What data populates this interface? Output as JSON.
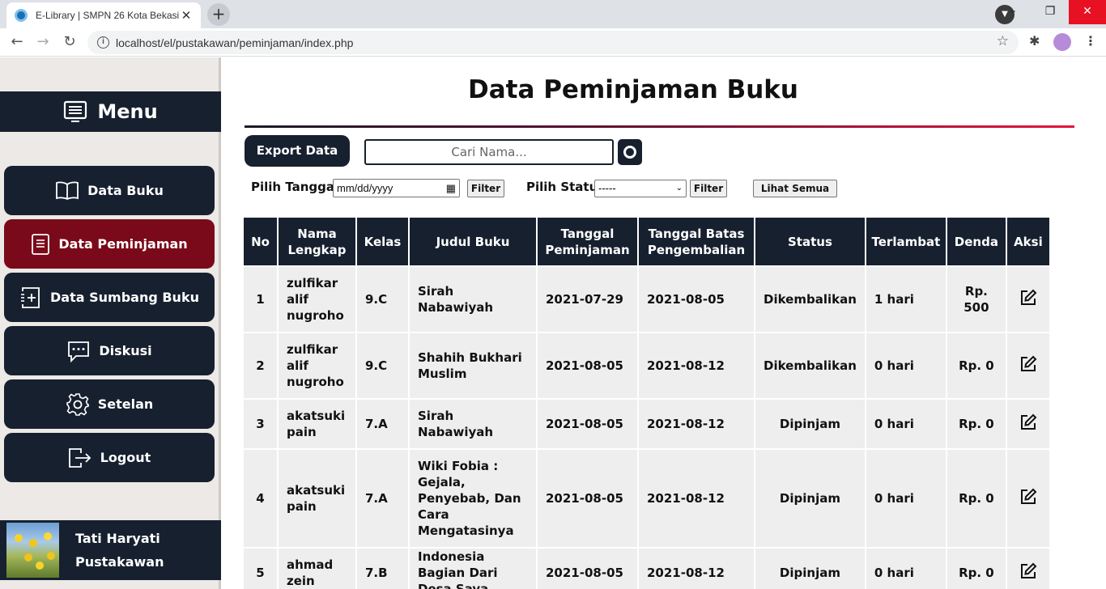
{
  "browser": {
    "tab_title": "E-Library | SMPN 26 Kota Bekasi",
    "url": "localhost/el/pustakawan/peminjaman/index.php"
  },
  "sidebar": {
    "menu_title": "Menu",
    "items": [
      {
        "label": "Data Buku",
        "icon": "book-icon"
      },
      {
        "label": "Data Peminjaman",
        "icon": "document-icon",
        "active": true
      },
      {
        "label": "Data Sumbang Buku",
        "icon": "add-file-icon"
      },
      {
        "label": "Diskusi",
        "icon": "chat-icon"
      },
      {
        "label": "Setelan",
        "icon": "gear-icon"
      },
      {
        "label": "Logout",
        "icon": "logout-icon"
      }
    ],
    "user": {
      "name": "Tati Haryati",
      "role": "Pustakawan"
    }
  },
  "main": {
    "title": "Data Peminjaman Buku",
    "export_label": "Export Data",
    "search_placeholder": "Cari Nama...",
    "filters": {
      "date_label": "Pilih Tanggal",
      "date_value": "mm/dd/yyyy",
      "filter_label": "Filter",
      "status_label": "Pilih Status",
      "status_value": "-----",
      "show_all_label": "Lihat Semua"
    },
    "table": {
      "headers": [
        "No",
        "Nama Lengkap",
        "Kelas",
        "Judul Buku",
        "Tanggal Peminjaman",
        "Tanggal Batas Pengembalian",
        "Status",
        "Terlambat",
        "Denda",
        "Aksi"
      ],
      "rows": [
        {
          "no": "1",
          "nama": "zulfikar alif nugroho",
          "kelas": "9.C",
          "judul": "Sirah Nabawiyah",
          "pinjam": "2021-07-29",
          "batas": "2021-08-05",
          "status": "Dikembalikan",
          "terlambat": "1 hari",
          "denda": "Rp. 500"
        },
        {
          "no": "2",
          "nama": "zulfikar alif nugroho",
          "kelas": "9.C",
          "judul": "Shahih Bukhari Muslim",
          "pinjam": "2021-08-05",
          "batas": "2021-08-12",
          "status": "Dikembalikan",
          "terlambat": "0 hari",
          "denda": "Rp. 0"
        },
        {
          "no": "3",
          "nama": "akatsuki pain",
          "kelas": "7.A",
          "judul": "Sirah Nabawiyah",
          "pinjam": "2021-08-05",
          "batas": "2021-08-12",
          "status": "Dipinjam",
          "terlambat": "0 hari",
          "denda": "Rp. 0"
        },
        {
          "no": "4",
          "nama": "akatsuki pain",
          "kelas": "7.A",
          "judul": "Wiki Fobia : Gejala, Penyebab, Dan Cara Mengatasinya",
          "pinjam": "2021-08-05",
          "batas": "2021-08-12",
          "status": "Dipinjam",
          "terlambat": "0 hari",
          "denda": "Rp. 0"
        },
        {
          "no": "5",
          "nama": "ahmad zein",
          "kelas": "7.B",
          "judul": "Indonesia Bagian Dari Desa Saya",
          "pinjam": "2021-08-05",
          "batas": "2021-08-12",
          "status": "Dipinjam",
          "terlambat": "0 hari",
          "denda": "Rp. 0"
        }
      ]
    }
  }
}
